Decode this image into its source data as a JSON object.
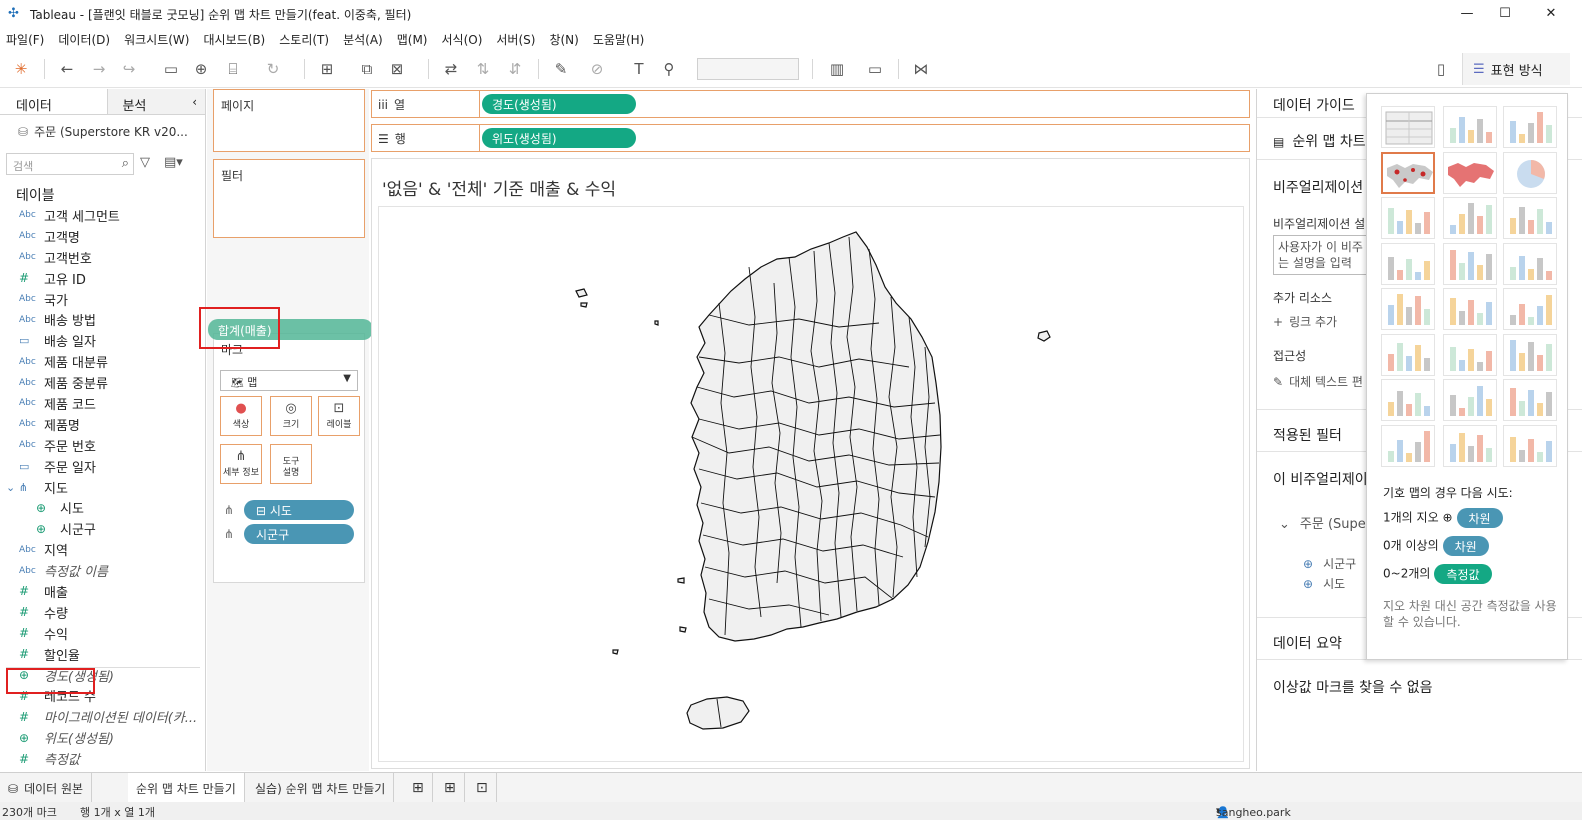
{
  "window": {
    "title": "Tableau - [플랜잇 태블로 굿모닝] 순위 맵 차트 만들기(feat. 이중축, 필터)"
  },
  "menu": [
    "파일(F)",
    "데이터(D)",
    "워크시트(W)",
    "대시보드(B)",
    "스토리(T)",
    "분석(A)",
    "맵(M)",
    "서식(O)",
    "서버(S)",
    "창(N)",
    "도움말(H)"
  ],
  "toolbar": {
    "show_me_label": "표현 방식"
  },
  "data_pane": {
    "tab_data": "데이터",
    "tab_analysis": "분석",
    "datasource": "주문 (Superstore KR v20...",
    "search_placeholder": "검색",
    "tables_heading": "테이블",
    "fields": [
      {
        "type": "Abc",
        "name": "고객 세그먼트"
      },
      {
        "type": "Abc",
        "name": "고객명"
      },
      {
        "type": "Abc",
        "name": "고객번호"
      },
      {
        "type": "#",
        "name": "고유 ID"
      },
      {
        "type": "Abc",
        "name": "국가"
      },
      {
        "type": "Abc",
        "name": "배송 방법"
      },
      {
        "type": "date",
        "name": "배송 일자"
      },
      {
        "type": "Abc",
        "name": "제품 대분류"
      },
      {
        "type": "Abc",
        "name": "제품 중분류"
      },
      {
        "type": "Abc",
        "name": "제품 코드"
      },
      {
        "type": "Abc",
        "name": "제품명"
      },
      {
        "type": "Abc",
        "name": "주문 번호"
      },
      {
        "type": "date",
        "name": "주문 일자"
      },
      {
        "type": "hier",
        "name": "지도"
      },
      {
        "type": "geo",
        "name": "시도"
      },
      {
        "type": "geo",
        "name": "시군구"
      },
      {
        "type": "Abc",
        "name": "지역"
      },
      {
        "type": "Abc",
        "name": "측정값 이름"
      },
      {
        "type": "#",
        "name": "매출"
      },
      {
        "type": "#",
        "name": "수량"
      },
      {
        "type": "#",
        "name": "수익"
      },
      {
        "type": "#",
        "name": "할인율"
      },
      {
        "type": "geo",
        "name": "경도(생성됨)"
      },
      {
        "type": "#=",
        "name": "레코드 수"
      },
      {
        "type": "#",
        "name": "마이그레이션된 데이터(카..."
      },
      {
        "type": "geo",
        "name": "위도(생성됨)"
      },
      {
        "type": "#",
        "name": "측정값"
      }
    ]
  },
  "shelves": {
    "pages": "페이지",
    "filters": "필터",
    "marks": "마크",
    "mark_type": "맵",
    "columns_label": "열",
    "rows_label": "행",
    "columns_pill": "경도(생성됨)",
    "rows_pill": "위도(생성됨)",
    "btn_color": "색상",
    "btn_size": "크기",
    "btn_label": "레이블",
    "btn_detail": "세부 정보",
    "btn_tooltip": "도구 설명",
    "pill_sido": "시도",
    "pill_sigungu": "시군구",
    "drag_pill": "합계(매출)"
  },
  "viz": {
    "title": "'없음' & '전체' 기준 매출 & 수익"
  },
  "guide": {
    "tab": "데이터 가이드",
    "sheet_name": "순위 맵 차트",
    "viz_desc_heading": "비주얼리제이션",
    "viz_desc_sub": "비주얼리제이션 설",
    "desc_placeholder": "사용자가 이 비주 되는 설명을 입력",
    "resources": "추가 리소스",
    "add_link": "링크 추가",
    "accessibility": "접근성",
    "alt_text": "대체 텍스트 편",
    "applied_filters": "적용된 필터",
    "this_viz": "이 비주얼리제이",
    "ds_item": "주문 (Supe",
    "geo1": "시군구",
    "geo2": "시도",
    "data_summary": "데이터 요약",
    "outliers": "이상값 마크를 찾을 수 없음"
  },
  "show_me": {
    "hint_heading": "기호 맵의 경우 다음 시도:",
    "hint1_prefix": "1개의 지오",
    "hint1_chip": "차원",
    "hint2_prefix": "0개 이상의",
    "hint2_chip": "차원",
    "hint3_prefix": "0~2개의",
    "hint3_chip": "측정값",
    "note": "지오 차원 대신 공간 측정값을 사용할 수 있습니다."
  },
  "tabs": {
    "datasource": "데이터 원본",
    "sheet1": "순위 맵 차트 만들기",
    "sheet2": "실습) 순위 맵 차트 만들기"
  },
  "status": {
    "marks": "230개 마크",
    "rows": "행 1개 x 열 1개",
    "user": "sangheo.park"
  },
  "colors": {
    "measure_green": "#14a884",
    "dimension_blue": "#4a96b4",
    "shelf_border": "#e8a06a",
    "highlight_red": "#e02020"
  }
}
